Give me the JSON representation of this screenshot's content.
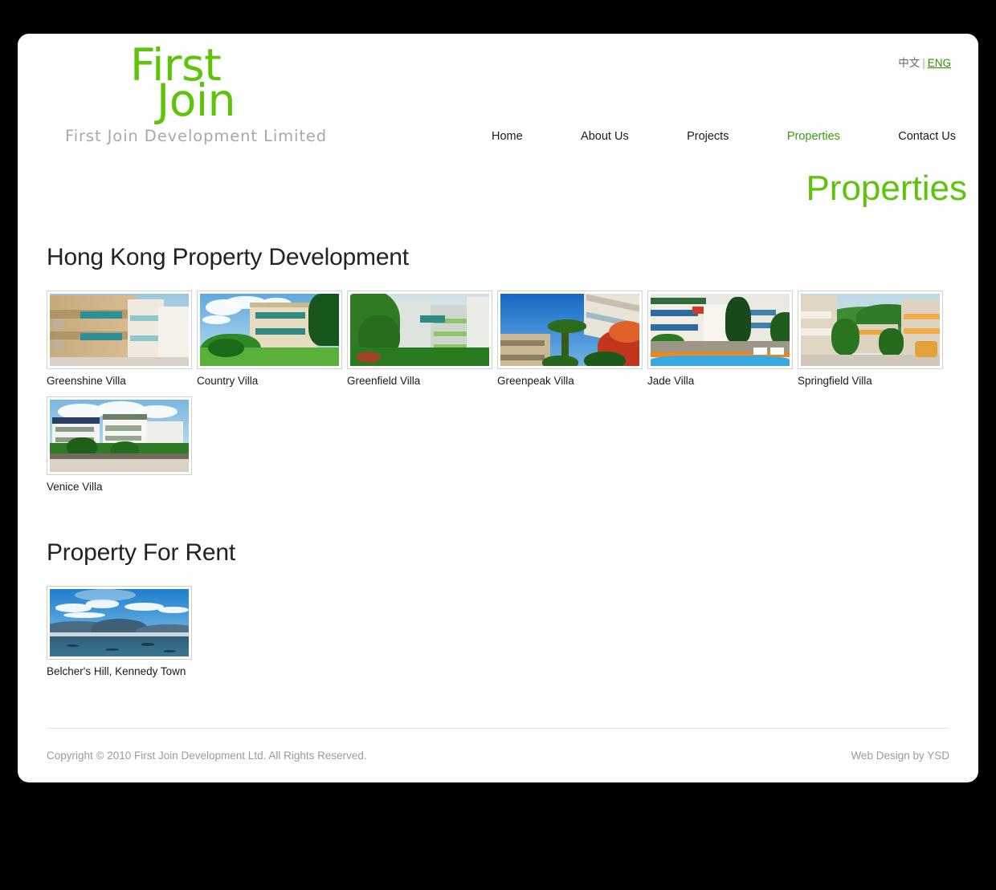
{
  "brand": {
    "logo_line1": "First",
    "logo_line2": "Join",
    "logo_subtitle": "First Join Development Limited",
    "accent_color": "#5ec40b"
  },
  "language": {
    "chinese": "中文",
    "separator": "|",
    "english": "ENG"
  },
  "nav": {
    "items": [
      {
        "label": "Home",
        "active": false
      },
      {
        "label": "About Us",
        "active": false
      },
      {
        "label": "Projects",
        "active": false
      },
      {
        "label": "Properties",
        "active": true
      },
      {
        "label": "Contact Us",
        "active": false
      }
    ]
  },
  "page": {
    "title": "Properties"
  },
  "sections": [
    {
      "heading": "Hong Kong Property Development",
      "items": [
        {
          "label": "Greenshine Villa",
          "image": "greenshine-villa-photo"
        },
        {
          "label": "Country Villa",
          "image": "country-villa-photo"
        },
        {
          "label": "Greenfield Villa",
          "image": "greenfield-villa-photo"
        },
        {
          "label": "Greenpeak Villa",
          "image": "greenpeak-villa-photo"
        },
        {
          "label": "Jade Villa",
          "image": "jade-villa-photo"
        },
        {
          "label": "Springfield Villa",
          "image": "springfield-villa-photo"
        },
        {
          "label": "Venice Villa",
          "image": "venice-villa-photo"
        }
      ]
    },
    {
      "heading": "Property For Rent",
      "items": [
        {
          "label": "Belcher's Hill, Kennedy Town",
          "image": "belchers-hill-photo"
        }
      ]
    }
  ],
  "footer": {
    "copyright": "Copyright © 2010 First Join Development Ltd. All Rights Reserved.",
    "credit": "Web Design by YSD"
  }
}
